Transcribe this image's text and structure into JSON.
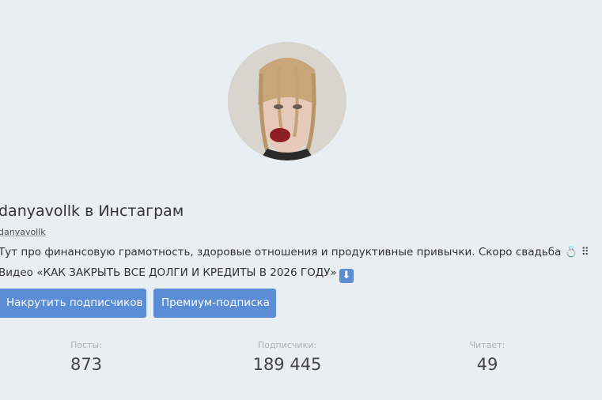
{
  "profile": {
    "title": "danyavollk в Инстаграм",
    "handle": "danyavollk",
    "bio_line1": "Тут про финансовую грамотность, здоровые отношения и продуктивные привычки. Скоро свадьба 💍 ⠿",
    "bio_line2": "Видео «КАК ЗАКРЫТЬ ВСЕ ДОЛГИ И КРЕДИТЫ В 2026 ГОДУ»",
    "bio_line2_icon": "⬇"
  },
  "buttons": {
    "boost_label": "Накрутить подписчиков",
    "premium_label": "Премиум-подписка"
  },
  "stats": {
    "posts_label": "Посты:",
    "posts_value": "873",
    "followers_label": "Подписчики:",
    "followers_value": "189 445",
    "following_label": "Читает:",
    "following_value": "49"
  },
  "colors": {
    "background": "#e9eef2",
    "accent": "#5b8dd6"
  },
  "icons": {
    "avatar": "profile-photo",
    "down_arrow": "down-arrow-emoji-icon"
  }
}
